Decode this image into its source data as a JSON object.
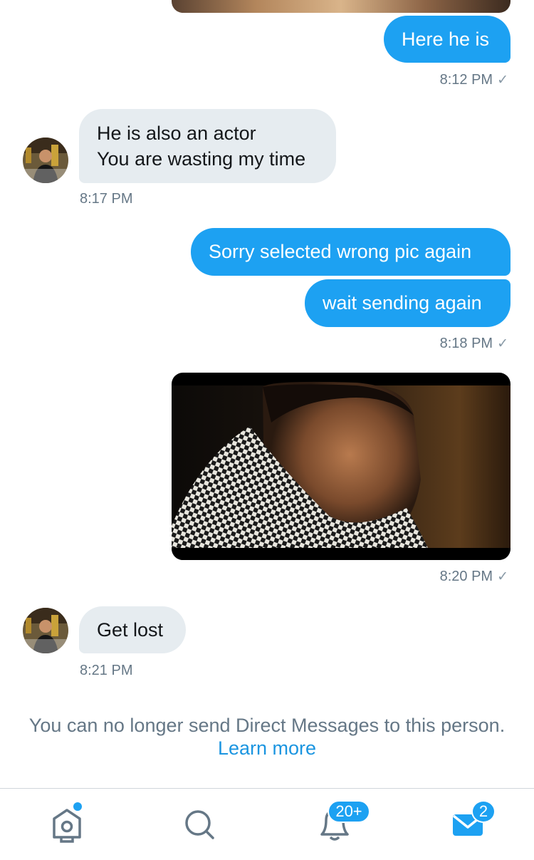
{
  "messages": [
    {
      "text": "Here he is"
    },
    {
      "time": "8:12 PM"
    },
    {
      "lines": [
        "He is also an actor",
        "You are wasting my time"
      ],
      "time": "8:17 PM"
    },
    {
      "text": "Sorry selected wrong pic again"
    },
    {
      "text": "wait sending again",
      "time": "8:18 PM"
    },
    {
      "time": "8:20 PM"
    },
    {
      "text": "Get lost",
      "time": "8:21 PM"
    }
  ],
  "notice": {
    "text": "You can no longer send Direct Messages to this person.",
    "link": "Learn more"
  },
  "tabbar": {
    "home": {
      "icon": "home-icon",
      "has_dot": true
    },
    "search": {
      "icon": "search-icon"
    },
    "notifications": {
      "icon": "bell-icon",
      "badge": "20+"
    },
    "messages": {
      "icon": "envelope-icon",
      "badge": "2"
    }
  },
  "colors": {
    "accent": "#1da1f2",
    "incoming_bubble": "#e6ecf0",
    "muted_text": "#657786",
    "link": "#1b95e0"
  }
}
